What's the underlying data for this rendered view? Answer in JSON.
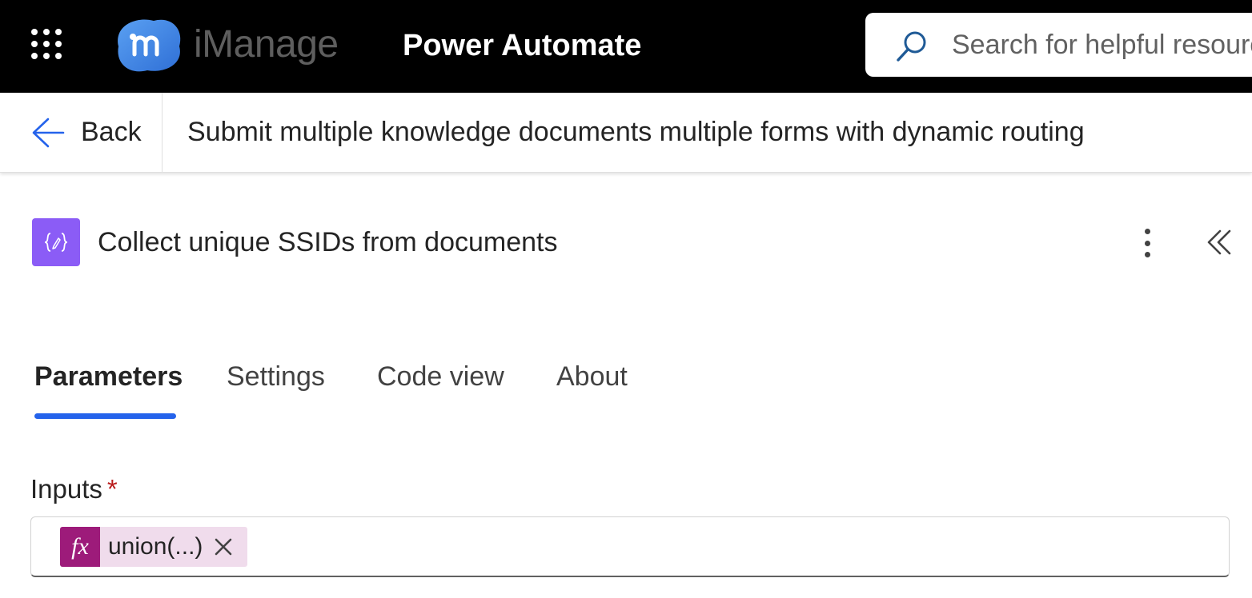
{
  "header": {
    "brand": "iManage",
    "app_title": "Power Automate",
    "search": {
      "placeholder": "Search for helpful resources"
    },
    "icons": {
      "launcher": "app-launcher-icon",
      "logo": "imanage-logo-icon",
      "search": "search-icon"
    }
  },
  "command_bar": {
    "back_label": "Back",
    "flow_name": "Submit multiple knowledge documents multiple forms with dynamic routing",
    "icons": {
      "back": "arrow-left-icon"
    }
  },
  "action": {
    "title": "Collect unique SSIDs from documents",
    "icon": "compose-variable-icon",
    "icon_color": "#8b5cf6",
    "more_icon": "more-vertical-icon",
    "collapse_icon": "chevron-double-left-icon"
  },
  "tabs": [
    {
      "label": "Parameters",
      "active": true
    },
    {
      "label": "Settings",
      "active": false
    },
    {
      "label": "Code view",
      "active": false
    },
    {
      "label": "About",
      "active": false
    }
  ],
  "parameters": {
    "inputs": {
      "label": "Inputs",
      "required_mark": "*",
      "token": {
        "icon_text": "fx",
        "label": "union(...)",
        "icon_color": "#9d1b7a",
        "remove_icon": "close-icon"
      }
    }
  },
  "colors": {
    "header_bg": "#000000",
    "tab_indicator": "#2563eb",
    "required": "#b91c1c"
  }
}
